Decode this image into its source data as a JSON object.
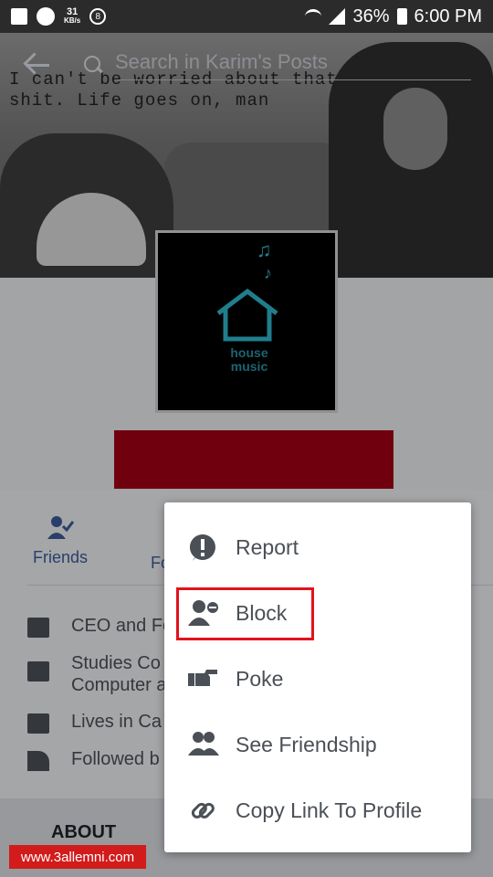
{
  "statusbar": {
    "kbs_num": "31",
    "kbs_unit": "KB/s",
    "badge": "8",
    "battery": "36%",
    "time": "6:00 PM"
  },
  "search": {
    "placeholder": "Search in Karim's Posts"
  },
  "cover": {
    "quote": "I can't be worried about that\nshit. Life goes on, man"
  },
  "avatar": {
    "label_line1": "house",
    "label_line2": "music"
  },
  "actions": {
    "friends_label": "Friends",
    "follow_partial": "Fo"
  },
  "info": [
    {
      "text": "CEO and Fo"
    },
    {
      "text": "Studies Co\nComputer a"
    },
    {
      "text": "Lives in Ca"
    },
    {
      "text": "Followed b"
    }
  ],
  "about_label": "ABOUT",
  "menu": {
    "items": [
      {
        "label": "Report",
        "icon": "exclamation-icon"
      },
      {
        "label": "Block",
        "icon": "block-user-icon"
      },
      {
        "label": "Poke",
        "icon": "poke-hand-icon"
      },
      {
        "label": "See Friendship",
        "icon": "friendship-icon"
      },
      {
        "label": "Copy Link To Profile",
        "icon": "link-icon"
      }
    ]
  },
  "watermark": "www.3allemni.com",
  "colors": {
    "fb_blue": "#3b5998",
    "highlight_red": "#e3121c",
    "name_bar": "#a30016",
    "icon_gray": "#4b4f56"
  }
}
